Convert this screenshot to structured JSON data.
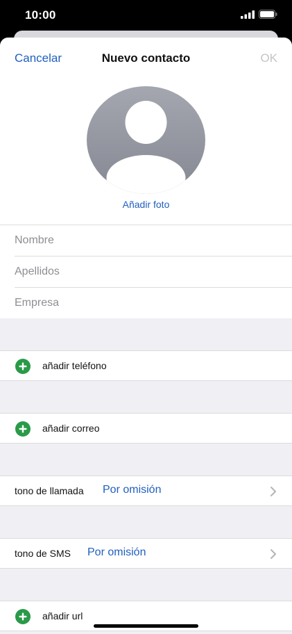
{
  "status_bar": {
    "time": "10:00"
  },
  "nav": {
    "cancel_label": "Cancelar",
    "title": "Nuevo contacto",
    "ok_label": "OK"
  },
  "photo": {
    "add_label": "Añadir foto"
  },
  "fields": {
    "first_name_placeholder": "Nombre",
    "last_name_placeholder": "Apellidos",
    "company_placeholder": "Empresa"
  },
  "rows": {
    "add_phone": "añadir teléfono",
    "add_email": "añadir correo",
    "ringtone_label": "tono de llamada",
    "ringtone_value": "Por omisión",
    "sms_tone_label": "tono de SMS",
    "sms_tone_value": "Por omisión",
    "add_url": "añadir url"
  },
  "colors": {
    "accent": "#1f5fbf",
    "add_green": "#2a9a48",
    "disabled": "#c4c4c6",
    "group_background": "#efeff4"
  },
  "icons": {
    "signal": "cellular-signal-icon",
    "battery": "battery-icon",
    "avatar": "person-placeholder-icon",
    "add": "plus-circle-icon",
    "chevron": "chevron-right-icon"
  }
}
